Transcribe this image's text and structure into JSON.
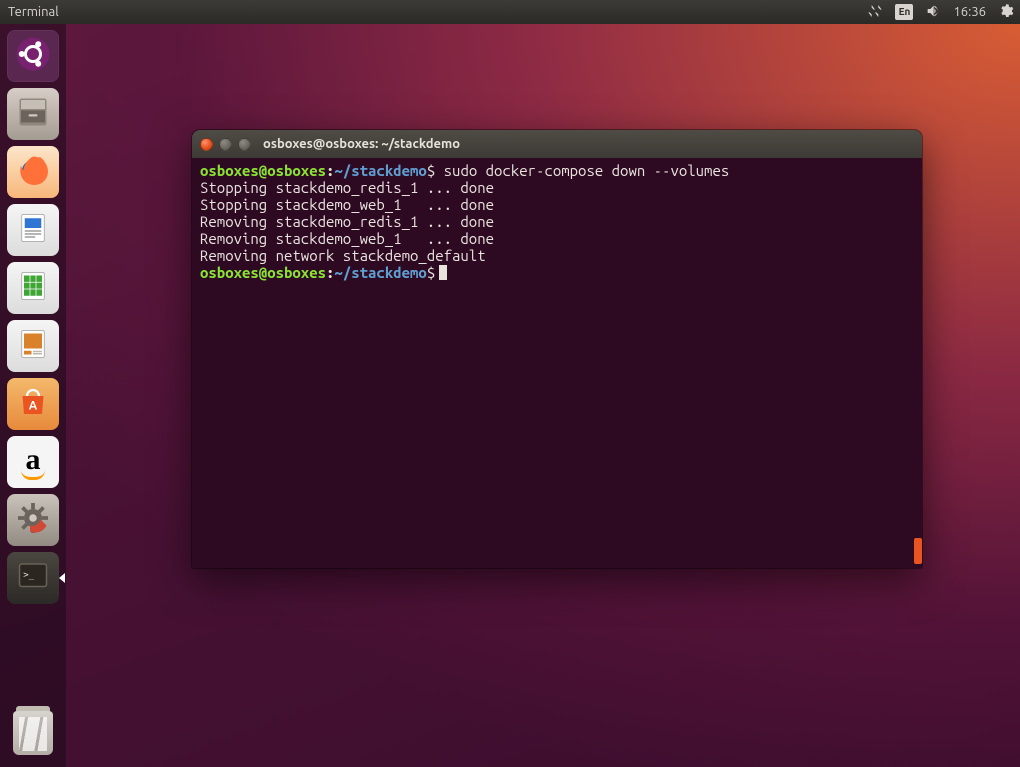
{
  "panel": {
    "active_app": "Terminal",
    "ime": "En",
    "clock": "16:36"
  },
  "launcher": {
    "items": [
      {
        "id": "dash",
        "tooltip": "Dash"
      },
      {
        "id": "files",
        "tooltip": "Files"
      },
      {
        "id": "firefox",
        "tooltip": "Firefox Web Browser"
      },
      {
        "id": "writer",
        "tooltip": "LibreOffice Writer"
      },
      {
        "id": "calc",
        "tooltip": "LibreOffice Calc"
      },
      {
        "id": "impress",
        "tooltip": "LibreOffice Impress"
      },
      {
        "id": "software",
        "tooltip": "Ubuntu Software"
      },
      {
        "id": "amazon",
        "tooltip": "Amazon"
      },
      {
        "id": "settings",
        "tooltip": "System Settings"
      },
      {
        "id": "terminal",
        "tooltip": "Terminal"
      }
    ],
    "trash_tooltip": "Trash"
  },
  "terminal": {
    "window_title": "osboxes@osboxes: ~/stackdemo",
    "prompt": {
      "user_host": "osboxes@osboxes",
      "separator": ":",
      "path": "~/stackdemo",
      "symbol": "$"
    },
    "command": "sudo docker-compose down --volumes",
    "output_lines": [
      "Stopping stackdemo_redis_1 ... done",
      "Stopping stackdemo_web_1   ... done",
      "Removing stackdemo_redis_1 ... done",
      "Removing stackdemo_web_1   ... done",
      "Removing network stackdemo_default"
    ]
  }
}
